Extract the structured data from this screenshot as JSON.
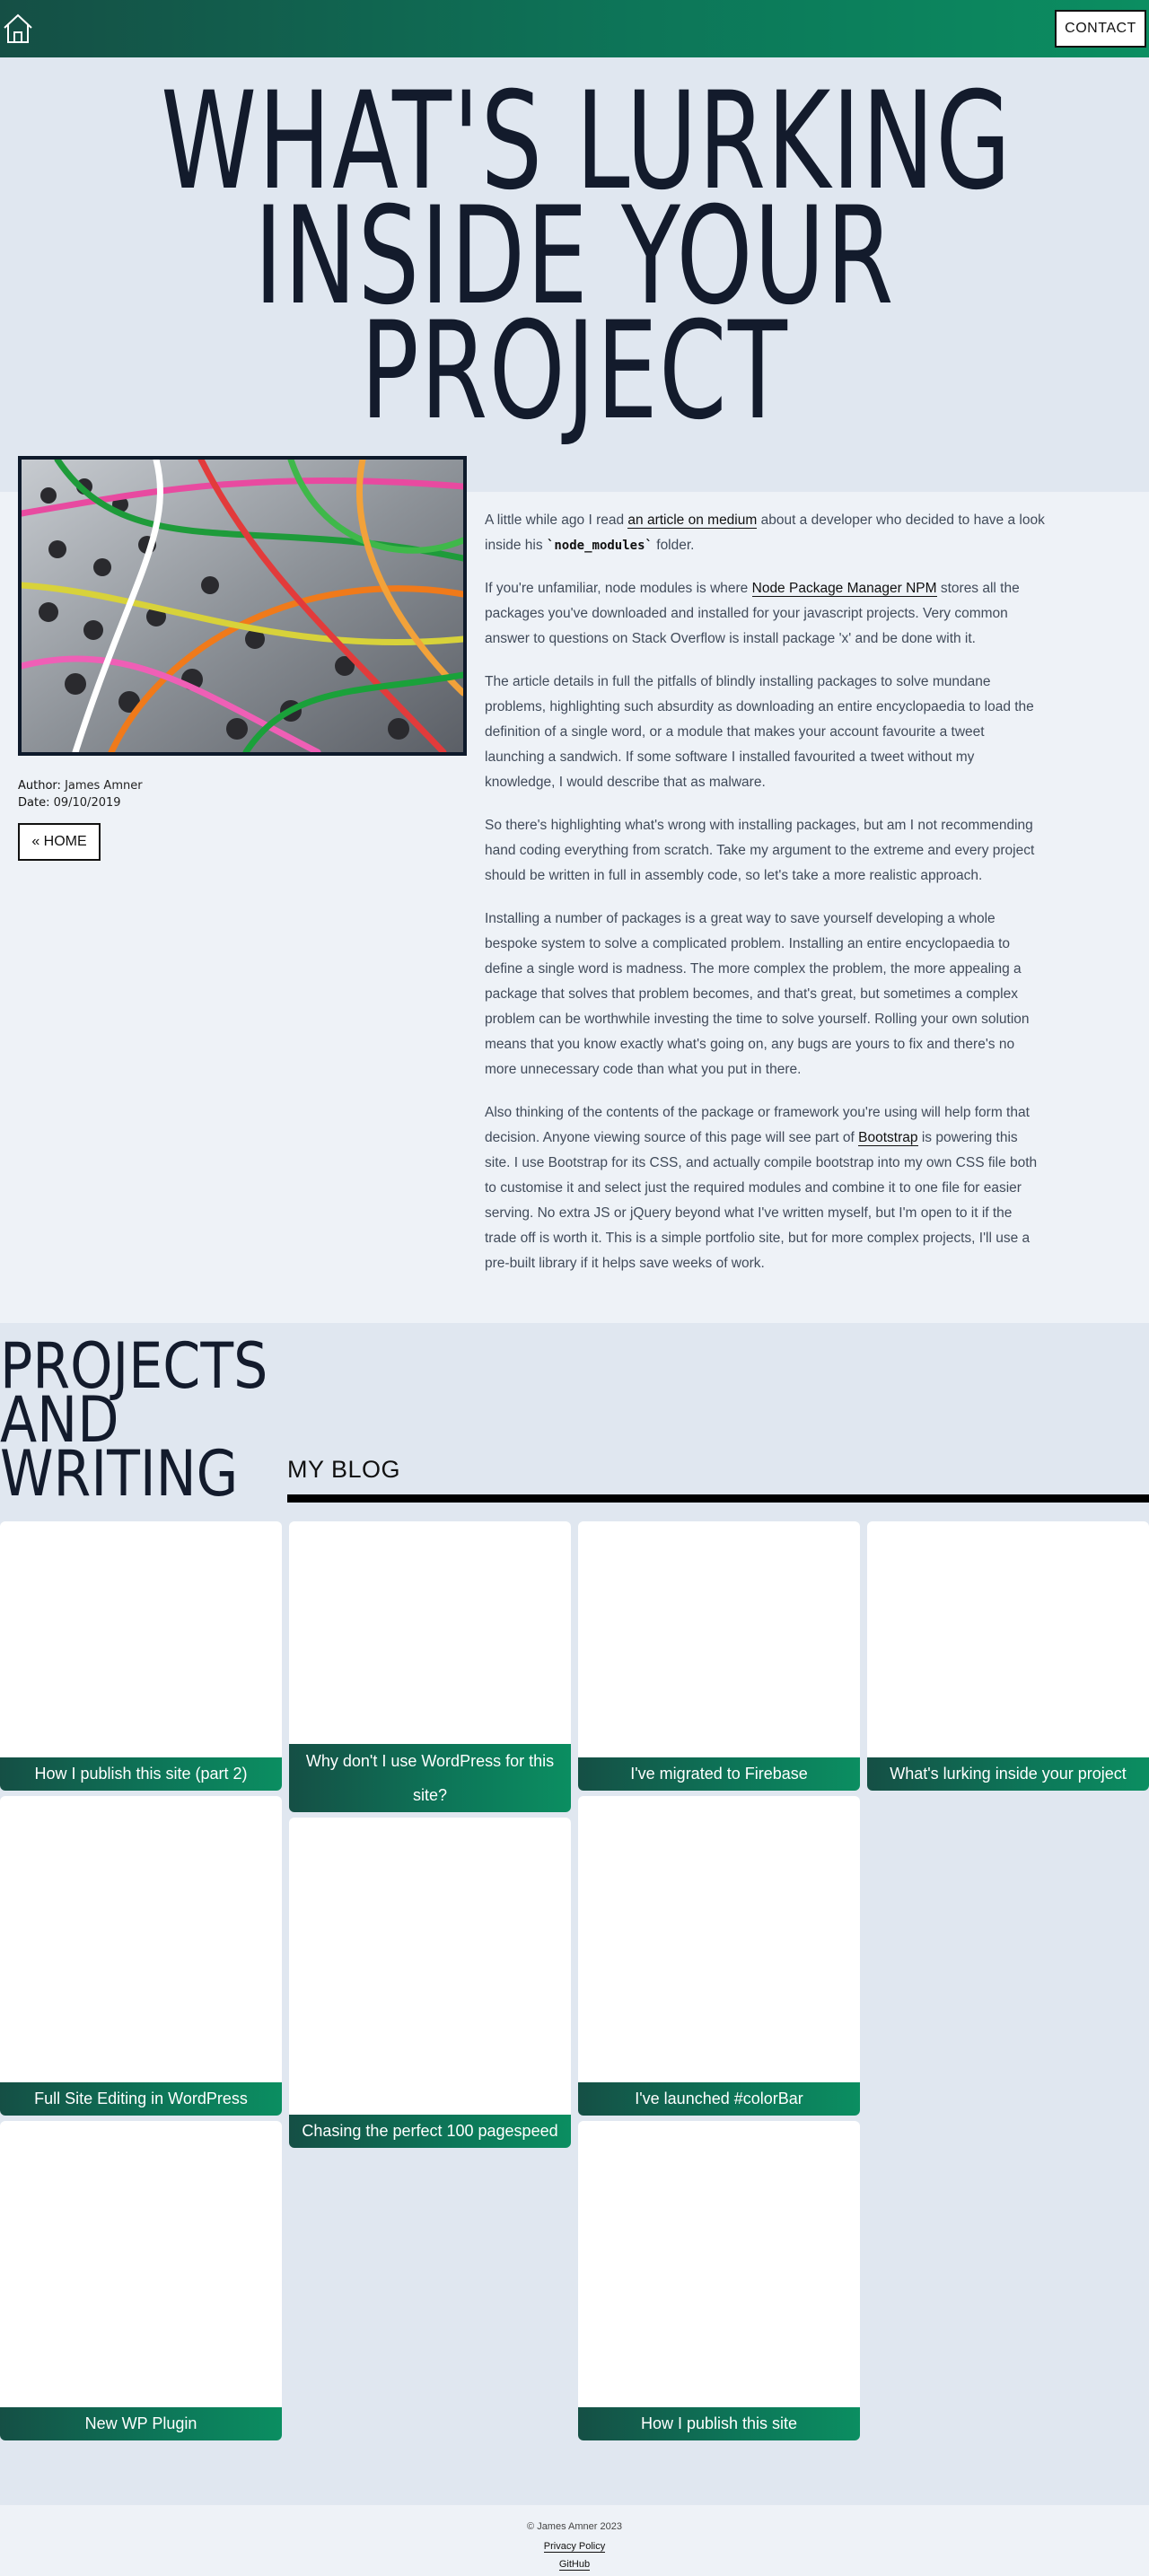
{
  "header": {
    "contact_label": "CONTACT"
  },
  "hero": {
    "title_lines": [
      "WHAT'S LURKING",
      "INSIDE YOUR",
      "PROJECT"
    ]
  },
  "article": {
    "author_label": "Author:",
    "author": "James Amner",
    "date_label": "Date:",
    "date": "09/10/2019",
    "home_label": "« HOME",
    "paragraphs": [
      {
        "a": "A little while ago I read ",
        "link": "an article on medium",
        "b": " about a developer who decided to have a look inside his ",
        "code": "`node_modules`",
        "c": " folder."
      },
      {
        "a": "If you're unfamiliar, node modules is where ",
        "link": "Node Package Manager NPM",
        "b": " stores all the packages you've downloaded and installed for your javascript projects. Very common answer to questions on Stack Overflow is install package 'x' and be done with it."
      },
      {
        "text": "The article details in full the pitfalls of blindly installing packages to solve mundane problems, highlighting such absurdity as downloading an entire encyclopaedia to load the definition of a single word, or a module that makes your account favourite a tweet launching a sandwich. If some software I installed favourited a tweet without my knowledge, I would describe that as malware."
      },
      {
        "text": "So there's highlighting what's wrong with installing packages, but am I not recommending hand coding everything from scratch. Take my argument to the extreme and every project should be written in full in assembly code, so let's take a more realistic approach."
      },
      {
        "text": "Installing a number of packages is a great way to save yourself developing a whole bespoke system to solve a complicated problem. Installing an entire encyclopaedia to define a single word is madness. The more complex the problem, the more appealing a package that solves that problem becomes, and that's great, but sometimes a complex problem can be worthwhile investing the time to solve yourself. Rolling your own solution means that you know exactly what's going on, any bugs are yours to fix and there's no more unnecessary code than what you put in there."
      },
      {
        "a": "Also thinking of the contents of the package or framework you're using will help form that decision. Anyone viewing source of this page will see part of ",
        "link": "Bootstrap",
        "b": " is powering this site. I use Bootstrap for its CSS, and actually compile bootstrap into my own CSS file both to customise it and select just the required modules and combine it to one file for easier serving. No extra JS or jQuery beyond what I've written myself, but I'm open to it if the trade off is worth it. This is a simple portfolio site, but for more complex projects, I'll use a pre-built library if it helps save weeks of work."
      }
    ]
  },
  "projects": {
    "heading_lines": [
      "PROJECTS",
      "AND",
      "WRITING"
    ],
    "blog_label": "MY BLOG",
    "posts": [
      "How I publish this site (part 2)",
      "Why don't I use WordPress for this site?",
      "I've migrated to Firebase",
      "What's lurking inside your project",
      "Full Site Editing in WordPress",
      "Chasing the perfect 100 pagespeed",
      "I've launched #colorBar",
      "New WP Plugin",
      "How I publish this site"
    ]
  },
  "footer": {
    "copyright": "© James Amner 2023",
    "privacy": "Privacy Policy",
    "github": "GitHub"
  },
  "colors": {
    "accent_dark": "#154f45",
    "accent_light": "#0b8e61",
    "hero_bg": "#e0e7f0",
    "article_bg": "#eef2f7",
    "title_text": "#131b2c"
  }
}
